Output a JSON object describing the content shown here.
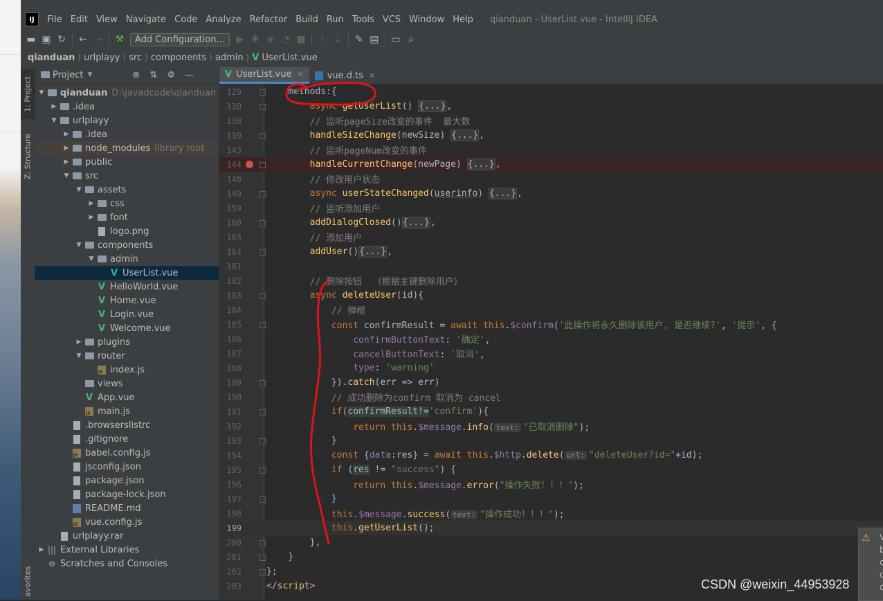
{
  "menu": {
    "items": [
      "File",
      "Edit",
      "View",
      "Navigate",
      "Code",
      "Analyze",
      "Refactor",
      "Build",
      "Run",
      "Tools",
      "VCS",
      "Window",
      "Help"
    ],
    "window_title": "qianduan - UserList.vue - IntelliJ IDEA",
    "logo_text": "IJ"
  },
  "toolbar": {
    "add_config_label": "Add Configuration..."
  },
  "breadcrumb": [
    "qianduan",
    "urlplayy",
    "src",
    "components",
    "admin",
    "UserList.vue"
  ],
  "left_strip": {
    "project": "1: Project",
    "structure": "Z: Structure",
    "favorites": "avorites"
  },
  "project_panel": {
    "title": "Project",
    "tree": [
      {
        "label": "qianduan",
        "note": "D:\\javadcode\\qianduan",
        "type": "folder",
        "depth": 0,
        "arrow": "down",
        "bold": true
      },
      {
        "label": ".idea",
        "type": "folder",
        "depth": 1,
        "arrow": "right"
      },
      {
        "label": "urlplayy",
        "type": "folder",
        "depth": 1,
        "arrow": "down"
      },
      {
        "label": ".idea",
        "type": "folder",
        "depth": 2,
        "arrow": "right"
      },
      {
        "label": "node_modules",
        "note": "library root",
        "type": "folder",
        "depth": 2,
        "arrow": "right",
        "lib": true
      },
      {
        "label": "public",
        "type": "folder",
        "depth": 2,
        "arrow": "right"
      },
      {
        "label": "src",
        "type": "folder",
        "depth": 2,
        "arrow": "down"
      },
      {
        "label": "assets",
        "type": "folder",
        "depth": 3,
        "arrow": "down"
      },
      {
        "label": "css",
        "type": "folder",
        "depth": 4,
        "arrow": "right"
      },
      {
        "label": "font",
        "type": "folder",
        "depth": 4,
        "arrow": "right"
      },
      {
        "label": "logo.png",
        "type": "file",
        "depth": 4
      },
      {
        "label": "components",
        "type": "folder",
        "depth": 3,
        "arrow": "down"
      },
      {
        "label": "admin",
        "type": "folder",
        "depth": 4,
        "arrow": "down"
      },
      {
        "label": "UserList.vue",
        "type": "vue",
        "depth": 5,
        "selected": true
      },
      {
        "label": "HelloWorld.vue",
        "type": "vue",
        "depth": 4
      },
      {
        "label": "Home.vue",
        "type": "vue",
        "depth": 4
      },
      {
        "label": "Login.vue",
        "type": "vue",
        "depth": 4
      },
      {
        "label": "Welcome.vue",
        "type": "vue",
        "depth": 4
      },
      {
        "label": "plugins",
        "type": "folder",
        "depth": 3,
        "arrow": "right"
      },
      {
        "label": "router",
        "type": "folder",
        "depth": 3,
        "arrow": "down"
      },
      {
        "label": "index.js",
        "type": "js",
        "depth": 4
      },
      {
        "label": "views",
        "type": "folder",
        "depth": 3
      },
      {
        "label": "App.vue",
        "type": "vue",
        "depth": 3
      },
      {
        "label": "main.js",
        "type": "js",
        "depth": 3
      },
      {
        "label": ".browserslistrc",
        "type": "file",
        "depth": 2
      },
      {
        "label": ".gitignore",
        "type": "file",
        "depth": 2
      },
      {
        "label": "babel.config.js",
        "type": "js",
        "depth": 2
      },
      {
        "label": "jsconfig.json",
        "type": "file",
        "depth": 2
      },
      {
        "label": "package.json",
        "type": "file",
        "depth": 2
      },
      {
        "label": "package-lock.json",
        "type": "file",
        "depth": 2
      },
      {
        "label": "README.md",
        "type": "md",
        "depth": 2
      },
      {
        "label": "vue.config.js",
        "type": "js",
        "depth": 2
      },
      {
        "label": "urlplayy.rar",
        "type": "file",
        "depth": 1
      },
      {
        "label": "External Libraries",
        "type": "lib",
        "depth": 0,
        "arrow": "right"
      },
      {
        "label": "Scratches and Consoles",
        "type": "scratch",
        "depth": 0
      }
    ]
  },
  "tabs": [
    {
      "label": "UserList.vue",
      "active": true
    },
    {
      "label": "vue.d.ts",
      "active": false
    }
  ],
  "code_lines": [
    {
      "n": "129",
      "parts": [
        [
          "    ",
          ""
        ],
        [
          "methods",
          ""
        ],
        [
          ":{",
          ""
        ]
      ]
    },
    {
      "n": "130",
      "parts": [
        [
          "        ",
          ""
        ],
        [
          "async ",
          "kw"
        ],
        [
          "getUserList",
          "fn"
        ],
        [
          "() ",
          ""
        ],
        [
          "{...}",
          "fd"
        ],
        [
          ",",
          ""
        ]
      ]
    },
    {
      "n": "138",
      "parts": [
        [
          "        ",
          ""
        ],
        [
          "// 监听pageSize改变的事件  最大数",
          "cm"
        ]
      ]
    },
    {
      "n": "139",
      "parts": [
        [
          "        ",
          ""
        ],
        [
          "handleSizeChange",
          "fn"
        ],
        [
          "(newSize) ",
          ""
        ],
        [
          "{...}",
          "fd"
        ],
        [
          ",",
          ""
        ]
      ]
    },
    {
      "n": "143",
      "parts": [
        [
          "        ",
          ""
        ],
        [
          "// 监听pageNum改变的事件",
          "cm"
        ]
      ]
    },
    {
      "n": "144",
      "parts": [
        [
          "        ",
          ""
        ],
        [
          "handleCurrentChange",
          "fn"
        ],
        [
          "(newPage) ",
          ""
        ],
        [
          "{...}",
          "fd"
        ],
        [
          ",",
          ""
        ]
      ],
      "bp": true
    },
    {
      "n": "148",
      "parts": [
        [
          "        ",
          ""
        ],
        [
          "// 修改用户状态",
          "cm"
        ]
      ]
    },
    {
      "n": "149",
      "parts": [
        [
          "        ",
          ""
        ],
        [
          "async ",
          "kw"
        ],
        [
          "userStateChanged",
          "fn"
        ],
        [
          "(",
          ""
        ],
        [
          "userinfo",
          "ul"
        ],
        [
          ") ",
          ""
        ],
        [
          "{...}",
          "fd"
        ],
        [
          ",",
          ""
        ]
      ]
    },
    {
      "n": "159",
      "parts": [
        [
          "        ",
          ""
        ],
        [
          "// 监听添加用户",
          "cm"
        ]
      ]
    },
    {
      "n": "160",
      "parts": [
        [
          "        ",
          ""
        ],
        [
          "addDialogClosed",
          "fn"
        ],
        [
          "()",
          ""
        ],
        [
          "{...}",
          "fd"
        ],
        [
          ",",
          ""
        ]
      ]
    },
    {
      "n": "163",
      "parts": [
        [
          "        ",
          ""
        ],
        [
          "// 添加用户",
          "cm"
        ]
      ]
    },
    {
      "n": "164",
      "parts": [
        [
          "        ",
          ""
        ],
        [
          "addUser",
          "fn"
        ],
        [
          "()",
          ""
        ],
        [
          "{...}",
          "fd"
        ],
        [
          ",",
          ""
        ]
      ]
    },
    {
      "n": "181",
      "parts": []
    },
    {
      "n": "182",
      "parts": [
        [
          "        ",
          ""
        ],
        [
          "// 删除按钮  （根据主键删除用户）",
          "cm"
        ]
      ]
    },
    {
      "n": "183",
      "parts": [
        [
          "        ",
          ""
        ],
        [
          "async ",
          "kw"
        ],
        [
          "deleteUser",
          "fn"
        ],
        [
          "(id){",
          ""
        ]
      ]
    },
    {
      "n": "184",
      "parts": [
        [
          "            ",
          ""
        ],
        [
          "// 弹框",
          "cm"
        ]
      ]
    },
    {
      "n": "185",
      "parts": [
        [
          "            ",
          ""
        ],
        [
          "const ",
          "kw"
        ],
        [
          "confirmResult = ",
          ""
        ],
        [
          "await ",
          "kw"
        ],
        [
          "this",
          "kw"
        ],
        [
          ".",
          ""
        ],
        [
          "$confirm",
          "pp"
        ],
        [
          "(",
          ""
        ],
        [
          "'此操作将永久删除该用户, 是否继续?'",
          "st"
        ],
        [
          ", ",
          ""
        ],
        [
          "'提示'",
          "st"
        ],
        [
          ", {",
          ""
        ]
      ]
    },
    {
      "n": "186",
      "parts": [
        [
          "                ",
          ""
        ],
        [
          "confirmButtonText",
          "pp"
        ],
        [
          ": ",
          ""
        ],
        [
          "'确定'",
          "st"
        ],
        [
          ",",
          ""
        ]
      ]
    },
    {
      "n": "187",
      "parts": [
        [
          "                ",
          ""
        ],
        [
          "cancelButtonText",
          "pp"
        ],
        [
          ": ",
          ""
        ],
        [
          "'取消'",
          "st"
        ],
        [
          ",",
          ""
        ]
      ]
    },
    {
      "n": "188",
      "parts": [
        [
          "                ",
          ""
        ],
        [
          "type",
          "pp"
        ],
        [
          ": ",
          ""
        ],
        [
          "'warning'",
          "st"
        ]
      ]
    },
    {
      "n": "189",
      "parts": [
        [
          "            ",
          ""
        ],
        [
          "}).",
          ""
        ],
        [
          "catch",
          "fn"
        ],
        [
          "(err => err)",
          ""
        ]
      ]
    },
    {
      "n": "190",
      "parts": [
        [
          "            ",
          ""
        ],
        [
          "// 成功删除为confirm 取消为 cancel",
          "cm"
        ]
      ]
    },
    {
      "n": "191",
      "parts": [
        [
          "            ",
          ""
        ],
        [
          "if",
          "kw"
        ],
        [
          "(",
          ""
        ],
        [
          "confirmResult!=",
          "hl"
        ],
        [
          "'confirm'",
          "st"
        ],
        [
          "){",
          ""
        ]
      ]
    },
    {
      "n": "192",
      "parts": [
        [
          "                ",
          ""
        ],
        [
          "return ",
          "kw"
        ],
        [
          "this",
          "kw"
        ],
        [
          ".",
          ""
        ],
        [
          "$message",
          "pp"
        ],
        [
          ".",
          ""
        ],
        [
          "info",
          "fn"
        ],
        [
          "(",
          ""
        ],
        [
          "text:",
          "hint"
        ],
        [
          "\"已取消删除\"",
          "st"
        ],
        [
          ");",
          ""
        ]
      ]
    },
    {
      "n": "193",
      "parts": [
        [
          "            ",
          ""
        ],
        [
          "}",
          ""
        ]
      ]
    },
    {
      "n": "194",
      "parts": [
        [
          "            ",
          ""
        ],
        [
          "const ",
          "kw"
        ],
        [
          "{",
          ""
        ],
        [
          "data",
          "pp"
        ],
        [
          ":res} = ",
          ""
        ],
        [
          "await ",
          "kw"
        ],
        [
          "this",
          "kw"
        ],
        [
          ".",
          ""
        ],
        [
          "$http",
          "pp"
        ],
        [
          ".",
          ""
        ],
        [
          "delete",
          "fn"
        ],
        [
          "(",
          ""
        ],
        [
          "url:",
          "hint"
        ],
        [
          "\"deleteUser?id=\"",
          "st"
        ],
        [
          "+id);",
          ""
        ]
      ]
    },
    {
      "n": "195",
      "parts": [
        [
          "            ",
          ""
        ],
        [
          "if ",
          "kw"
        ],
        [
          "(",
          ""
        ],
        [
          "res",
          "hl"
        ],
        [
          " != ",
          ""
        ],
        [
          "\"success\"",
          "st"
        ],
        [
          ") {",
          ""
        ]
      ]
    },
    {
      "n": "196",
      "parts": [
        [
          "                ",
          ""
        ],
        [
          "return ",
          "kw"
        ],
        [
          "this",
          "kw"
        ],
        [
          ".",
          ""
        ],
        [
          "$message",
          "pp"
        ],
        [
          ".",
          ""
        ],
        [
          "error",
          "fn"
        ],
        [
          "(",
          ""
        ],
        [
          "\"操作失败！！！\"",
          "st"
        ],
        [
          ");",
          ""
        ]
      ]
    },
    {
      "n": "197",
      "parts": [
        [
          "            ",
          ""
        ],
        [
          "}",
          ""
        ]
      ]
    },
    {
      "n": "198",
      "parts": [
        [
          "            ",
          ""
        ],
        [
          "this",
          "kw"
        ],
        [
          ".",
          ""
        ],
        [
          "$message",
          "pp"
        ],
        [
          ".",
          ""
        ],
        [
          "success",
          "fn"
        ],
        [
          "(",
          ""
        ],
        [
          "text:",
          "hint"
        ],
        [
          "\"操作成功！！！\"",
          "st"
        ],
        [
          ");",
          ""
        ]
      ]
    },
    {
      "n": "199",
      "parts": [
        [
          "            ",
          ""
        ],
        [
          "this",
          "kw"
        ],
        [
          ".",
          ""
        ],
        [
          "getUserList",
          "fn"
        ],
        [
          "();",
          ""
        ]
      ],
      "cur": true
    },
    {
      "n": "200",
      "parts": [
        [
          "        ",
          ""
        ],
        [
          "},",
          ""
        ]
      ]
    },
    {
      "n": "201",
      "parts": [
        [
          "    ",
          ""
        ],
        [
          "}",
          ""
        ]
      ]
    },
    {
      "n": "202",
      "parts": [
        [
          "",
          ""
        ],
        [
          "};",
          ""
        ]
      ]
    },
    {
      "n": "203",
      "parts": [
        [
          "",
          ""
        ],
        [
          "</",
          ""
        ],
        [
          "script",
          "gt"
        ],
        [
          ">",
          ""
        ]
      ]
    }
  ],
  "notification": {
    "lines": [
      "V",
      "b",
      "c",
      "c",
      "c"
    ]
  },
  "watermark": "CSDN @weixin_44953928",
  "colors": {
    "vue_green": "#41b883",
    "selection": "#0d293e",
    "annotation_red": "#e0121b"
  }
}
